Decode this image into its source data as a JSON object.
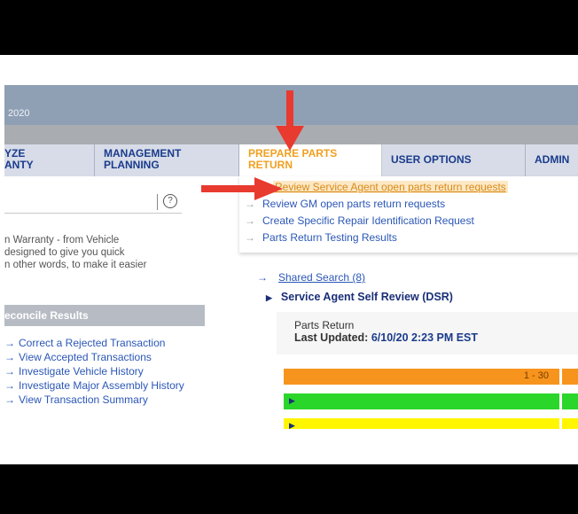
{
  "banner": {
    "year": "2020"
  },
  "tabs": [
    {
      "label_line1": "YZE",
      "label_line2": "ANTY"
    },
    {
      "label_line1": "MANAGEMENT",
      "label_line2": "PLANNING"
    },
    {
      "label_line1": "PREPARE PARTS",
      "label_line2": "RETURN"
    },
    {
      "label_line1": "USER OPTIONS",
      "label_line2": ""
    },
    {
      "label_line1": "ADMIN",
      "label_line2": ""
    }
  ],
  "dropdown": {
    "items": [
      "Review Service Agent open parts return requests",
      "Review GM open parts return requests",
      "Create Specific Repair Identification Request",
      "Parts Return Testing Results"
    ]
  },
  "help_icon_glyph": "?",
  "description": [
    "n Warranty - from Vehicle",
    "designed to give you quick",
    "n other words, to make it easier"
  ],
  "panel": {
    "header": "econcile Results",
    "tasks": [
      "Correct a Rejected Transaction",
      "View Accepted Transactions",
      "Investigate Vehicle History",
      "Investigate Major Assembly History",
      "View Transaction Summary"
    ]
  },
  "right": {
    "shared_search": "Shared Search (8)",
    "section_title": "Service Agent Self Review (DSR)",
    "parts_return_label": "Parts Return",
    "last_updated_label": "Last Updated:",
    "last_updated_value": "6/10/20 2:23 PM EST",
    "bar_range": "1 - 30"
  },
  "colors": {
    "nav_blue": "#1a3b8c",
    "link_blue": "#2b57b7",
    "active_tab_orange": "#f0a020",
    "bar_orange": "#f7941d",
    "bar_green": "#2ad62a",
    "bar_yellow": "#fff600",
    "annotation_red": "#e83a2f"
  }
}
